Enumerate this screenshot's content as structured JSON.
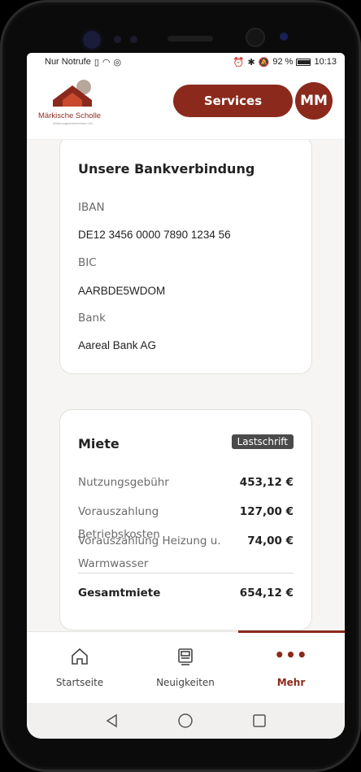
{
  "status_bar": {
    "carrier": "Nur Notrufe",
    "battery": "92 %",
    "time": "10:13"
  },
  "header": {
    "brand_name": "Märkische Scholle",
    "brand_tagline": "Wohnungsunternehmen eG",
    "services_label": "Services",
    "avatar_initials": "MM"
  },
  "bank": {
    "title": "Unsere Bankverbindung",
    "iban_label": "IBAN",
    "iban_value": "DE12 3456 0000 7890 1234 56",
    "bic_label": "BIC",
    "bic_value": "AARBDE5WDOM",
    "bank_label": "Bank",
    "bank_value": "Aareal Bank AG"
  },
  "rent": {
    "title": "Miete",
    "badge": "Lastschrift",
    "rows": [
      {
        "label": "Nutzungsgebühr",
        "value": "453,12 €"
      },
      {
        "label": "Vorauszahlung Betriebskosten",
        "value": "127,00 €"
      },
      {
        "label": "Vorauszahlung Heizung u. Warmwasser",
        "value": "74,00 €"
      }
    ],
    "total_label": "Gesamtmiete",
    "total_value": "654,12 €"
  },
  "bottom_nav": {
    "items": [
      {
        "label": "Startseite",
        "icon": "home-icon"
      },
      {
        "label": "Neuigkeiten",
        "icon": "news-icon"
      },
      {
        "label": "Mehr",
        "icon": "more-icon",
        "active": true
      }
    ]
  },
  "colors": {
    "accent": "#8b2a1c",
    "background": "#f6f5f3",
    "badge": "#4a4a4a"
  }
}
